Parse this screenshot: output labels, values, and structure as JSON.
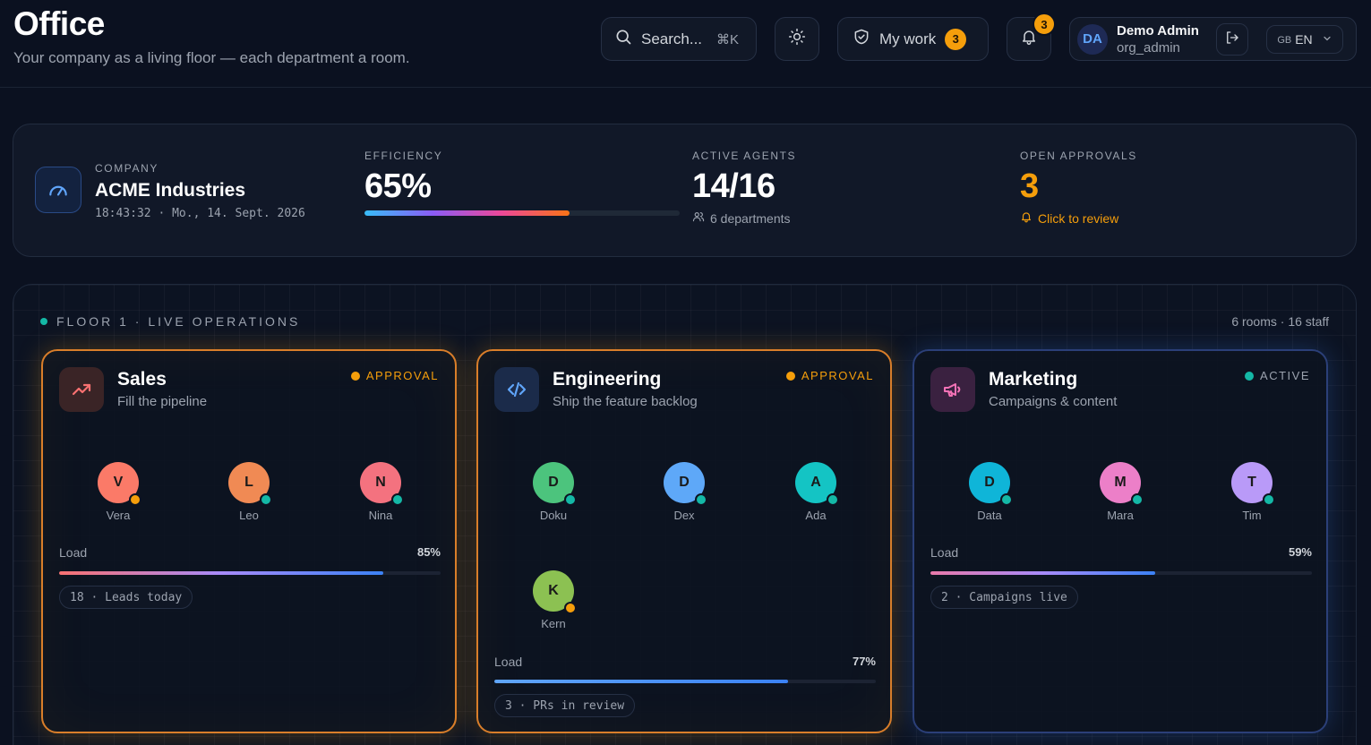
{
  "header": {
    "title": "Office",
    "subtitle": "Your company as a living floor — each department a room.",
    "search_label": "Search...",
    "search_shortcut": "⌘K",
    "my_work_label": "My work",
    "my_work_count": "3",
    "notifications_count": "3",
    "user": {
      "initials": "DA",
      "name": "Demo Admin",
      "role": "org_admin"
    },
    "language": {
      "flag": "GB",
      "code": "EN"
    }
  },
  "stats": {
    "company_label": "COMPANY",
    "company_name": "ACME Industries",
    "datetime": "18:43:32 · Mo., 14. Sept. 2026",
    "efficiency_label": "EFFICIENCY",
    "efficiency_value": "65%",
    "efficiency_fraction": 0.65,
    "agents_label": "ACTIVE AGENTS",
    "agents_value": "14/16",
    "departments": "6 departments",
    "approvals_label": "OPEN APPROVALS",
    "approvals_value": "3",
    "approvals_link": "Click to review"
  },
  "floor": {
    "label": "FLOOR 1 · LIVE OPERATIONS",
    "meta": "6 rooms · 16 staff",
    "rooms": [
      {
        "title": "Sales",
        "subtitle": "Fill the pipeline",
        "status": "APPROVAL",
        "load_label": "Load",
        "load": "85%",
        "load_fraction": 0.85,
        "chip": "18 · Leads today",
        "agents": [
          {
            "initial": "V",
            "name": "Vera"
          },
          {
            "initial": "L",
            "name": "Leo"
          },
          {
            "initial": "N",
            "name": "Nina"
          }
        ]
      },
      {
        "title": "Engineering",
        "subtitle": "Ship the feature backlog",
        "status": "APPROVAL",
        "load_label": "Load",
        "load": "77%",
        "load_fraction": 0.77,
        "chip": "3 · PRs in review",
        "agents": [
          {
            "initial": "D",
            "name": "Doku"
          },
          {
            "initial": "D",
            "name": "Dex"
          },
          {
            "initial": "A",
            "name": "Ada"
          },
          {
            "initial": "K",
            "name": "Kern"
          }
        ]
      },
      {
        "title": "Marketing",
        "subtitle": "Campaigns & content",
        "status": "ACTIVE",
        "load_label": "Load",
        "load": "59%",
        "load_fraction": 0.59,
        "chip": "2 · Campaigns live",
        "agents": [
          {
            "initial": "D",
            "name": "Data"
          },
          {
            "initial": "M",
            "name": "Mara"
          },
          {
            "initial": "T",
            "name": "Tim"
          }
        ]
      }
    ]
  },
  "colors": {
    "approval": "#f59e0b",
    "active": "#14b8a6",
    "accent_blue": "#3b82f6"
  },
  "icons": [
    "search-icon",
    "sun-icon",
    "shield-icon",
    "bell-icon",
    "logout-icon",
    "chevron-down-icon",
    "gauge-icon",
    "users-icon",
    "trending-up-icon",
    "code-icon",
    "megaphone-icon"
  ]
}
